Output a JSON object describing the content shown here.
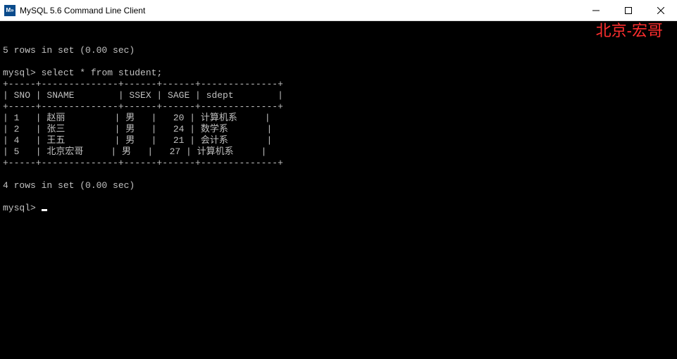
{
  "window": {
    "title": "MySQL 5.6 Command Line Client",
    "icon_label": "M»"
  },
  "watermark": "北京-宏哥",
  "terminal": {
    "prev_result": "5 rows in set (0.00 sec)",
    "prompt": "mysql>",
    "query": "select * from student;",
    "border": "+-----+--------------+------+------+--------------+",
    "headers": [
      "SNO",
      "SNAME",
      "SSEX",
      "SAGE",
      "sdept"
    ],
    "rows": [
      {
        "sno": "1",
        "sname": "赵丽",
        "ssex": "男",
        "sage": "20",
        "sdept": "计算机系"
      },
      {
        "sno": "2",
        "sname": "张三",
        "ssex": "男",
        "sage": "24",
        "sdept": "数学系"
      },
      {
        "sno": "4",
        "sname": "王五",
        "ssex": "男",
        "sage": "21",
        "sdept": "会计系"
      },
      {
        "sno": "5",
        "sname": "北京宏哥",
        "ssex": "男",
        "sage": "27",
        "sdept": "计算机系"
      }
    ],
    "result": "4 rows in set (0.00 sec)"
  }
}
